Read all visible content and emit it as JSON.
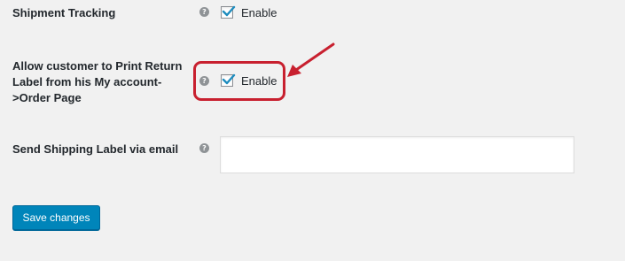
{
  "settings": {
    "shipment_tracking": {
      "label": "Shipment Tracking",
      "help_icon": "question-mark-icon",
      "checked": true,
      "checkbox_label": "Enable"
    },
    "print_return_label": {
      "label_lines": [
        "Allow customer to Print Return",
        "Label from his My account-",
        ">Order Page"
      ],
      "help_icon": "question-mark-icon",
      "checked": true,
      "checkbox_label": "Enable"
    },
    "send_shipping_label": {
      "label": "Send Shipping Label via email",
      "help_icon": "question-mark-icon",
      "value": ""
    }
  },
  "annotation": {
    "color": "#c8202f",
    "arrow_icon": "red-arrow-icon"
  },
  "actions": {
    "save_label": "Save changes"
  },
  "colors": {
    "background": "#f1f1f1",
    "primary_button": "#0085ba",
    "text": "#23282d"
  }
}
